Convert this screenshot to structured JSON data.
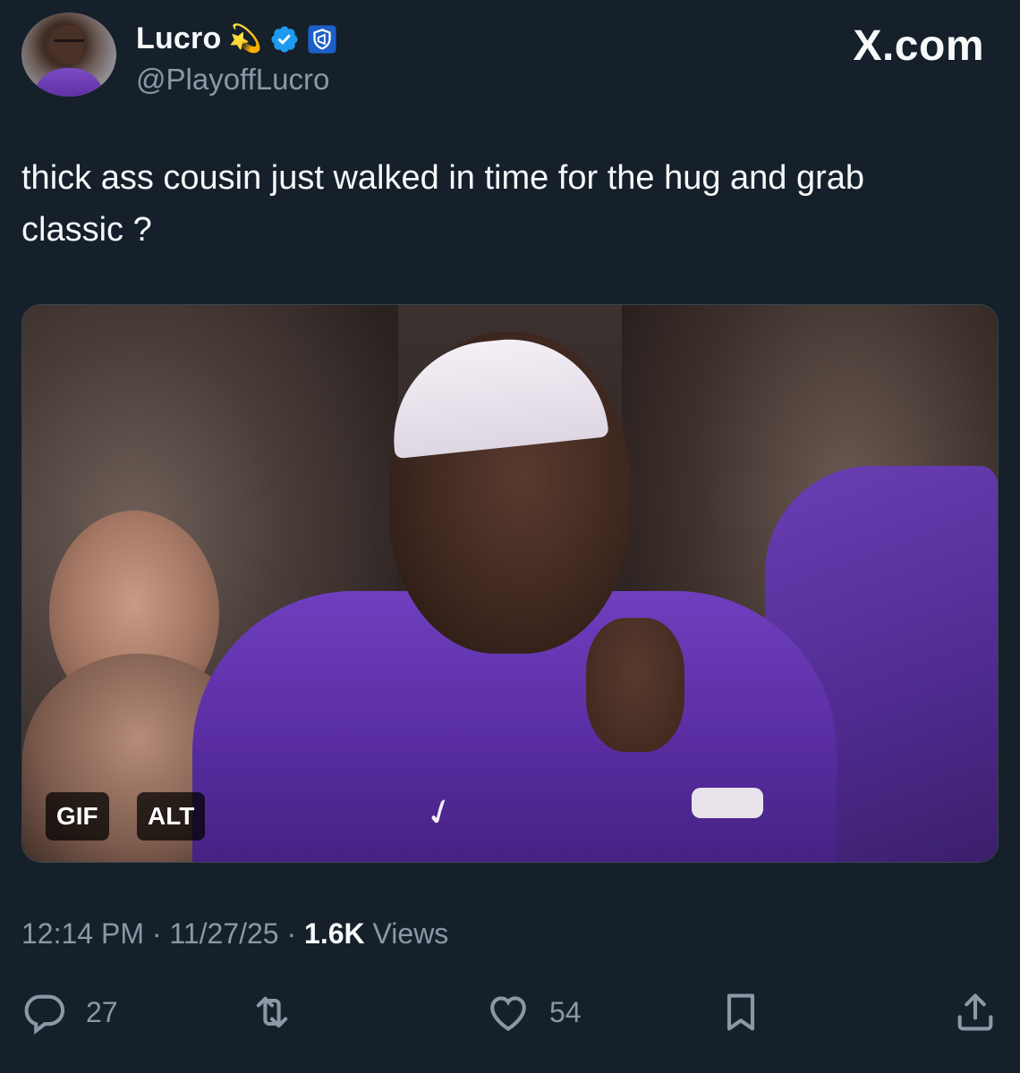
{
  "author": {
    "display_name": "Lucro",
    "emoji": "💫",
    "handle": "@PlayoffLucro"
  },
  "brand": "X.com",
  "tweet": {
    "text": "thick ass cousin just walked in time for the hug and grab\nclassic ?"
  },
  "media": {
    "gif_label": "GIF",
    "alt_label": "ALT"
  },
  "meta": {
    "time": "12:14 PM",
    "separator": " · ",
    "date": "11/27/25",
    "views_count": "1.6K",
    "views_label": "Views"
  },
  "actions": {
    "replies": "27",
    "likes": "54"
  },
  "colors": {
    "background": "#15202b",
    "primary_text": "#f7f9f9",
    "secondary_text": "#8b98a5",
    "verified_blue": "#1d9bf0"
  }
}
